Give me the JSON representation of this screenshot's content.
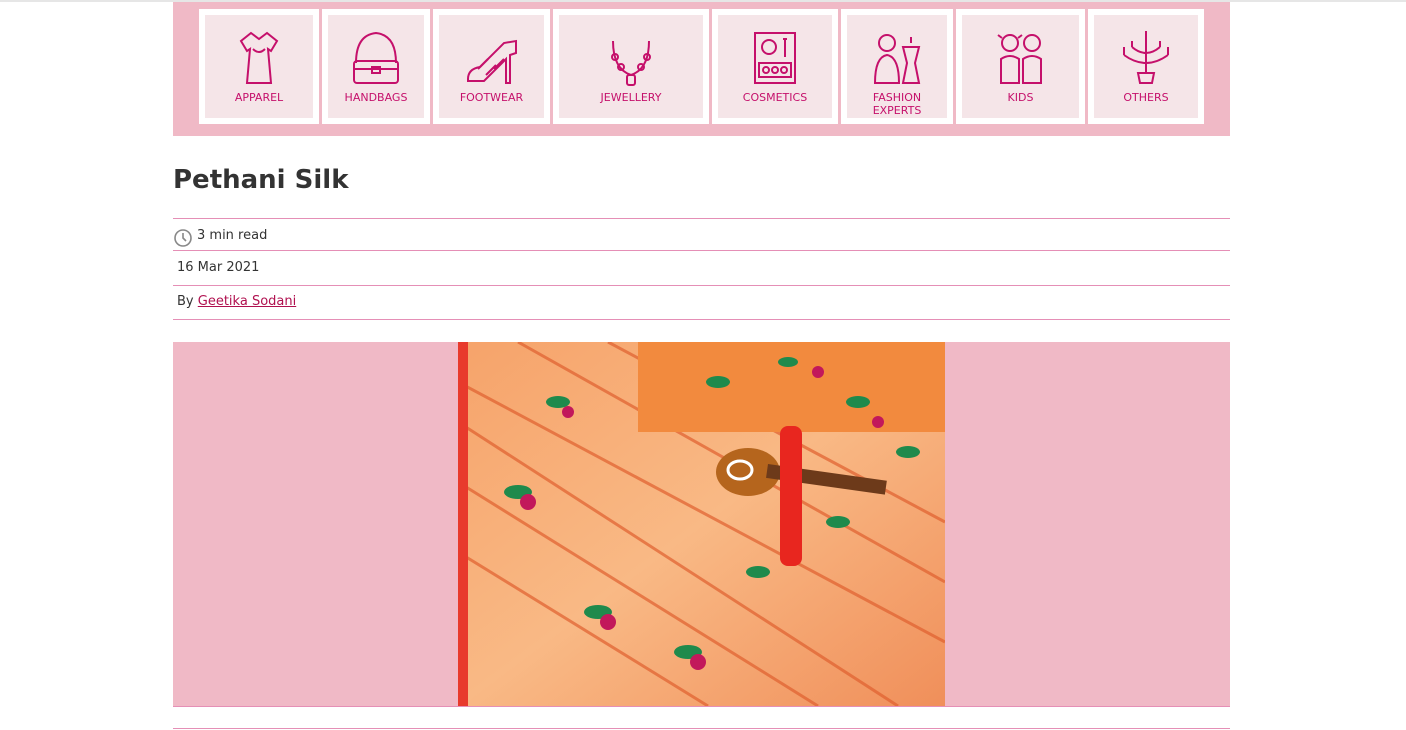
{
  "categories": [
    {
      "label": "APPAREL",
      "icon": "dress-icon"
    },
    {
      "label": "HANDBAGS",
      "icon": "handbag-icon"
    },
    {
      "label": "FOOTWEAR",
      "icon": "heel-shoe-icon"
    },
    {
      "label": "JEWELLERY",
      "icon": "necklace-icon"
    },
    {
      "label": "COSMETICS",
      "icon": "makeup-palette-icon"
    },
    {
      "label": "FASHION EXPERTS",
      "icon": "designer-mannequin-icon"
    },
    {
      "label": "KIDS",
      "icon": "kids-icon"
    },
    {
      "label": "OTHERS",
      "icon": "chandelier-icon"
    }
  ],
  "article": {
    "title": "Pethani Silk",
    "read_time": "3 min read",
    "date": "16 Mar 2021",
    "by_prefix": "By",
    "author": "Geetika Sodani"
  },
  "colors": {
    "accent": "#c5106b",
    "bar_pink": "#f0b9c6",
    "divider": "#e58fb6"
  }
}
